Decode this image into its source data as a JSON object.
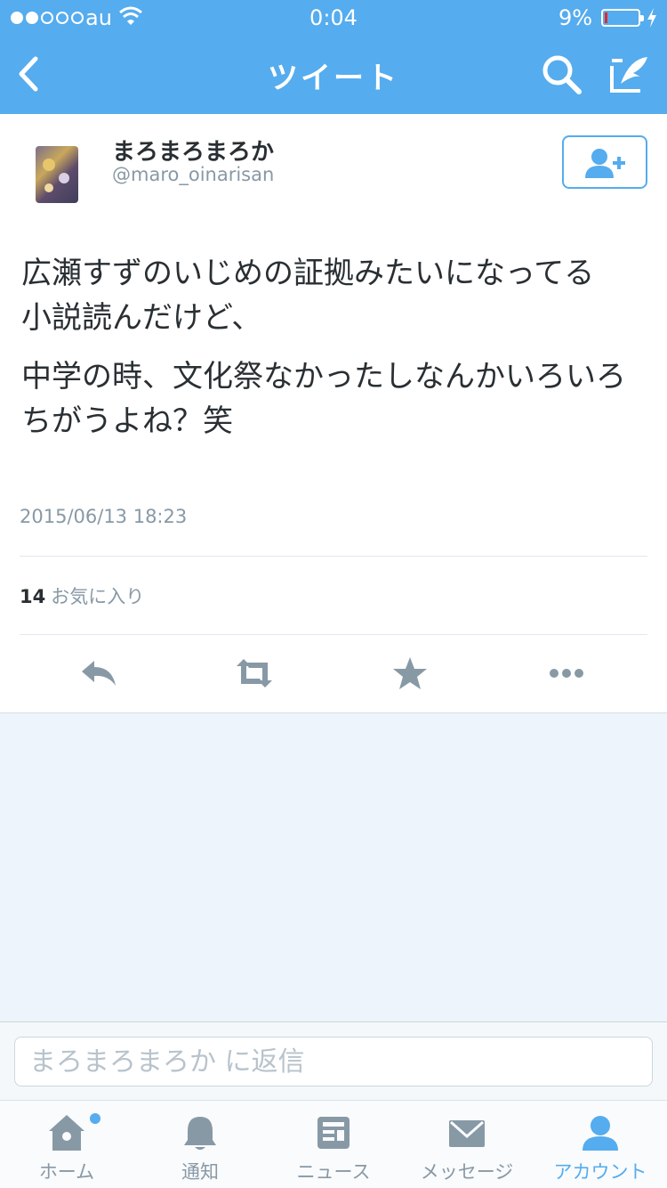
{
  "status_bar": {
    "carrier": "au",
    "time": "0:04",
    "battery_percent": "9%",
    "battery_level": 0.09,
    "signal_bars": 2,
    "signal_total": 5
  },
  "nav": {
    "title": "ツイート",
    "icons": [
      "chevron-left-icon",
      "search-icon",
      "compose-icon"
    ]
  },
  "tweet": {
    "display_name": "まろまろまろか",
    "handle": "@maro_oinarisan",
    "paragraph_1": "広瀬すずのいじめの証拠みたいになってる\n小説読んだけど、",
    "paragraph_2": "中学の時、文化祭なかったしなんかいろいろちがうよね？笑",
    "timestamp": "2015/06/13 18:23",
    "favorites_count": "14",
    "favorites_label": "お気に入り"
  },
  "actions": [
    "reply-icon",
    "retweet-icon",
    "favorite-icon",
    "more-icon"
  ],
  "reply": {
    "placeholder": "まろまろまろか に返信"
  },
  "tabs": [
    {
      "label": "ホーム",
      "icon": "home-icon",
      "has_notification_dot": true
    },
    {
      "label": "通知",
      "icon": "bell-icon"
    },
    {
      "label": "ニュース",
      "icon": "news-icon"
    },
    {
      "label": "メッセージ",
      "icon": "envelope-icon"
    },
    {
      "label": "アカウント",
      "icon": "person-icon",
      "active": true
    }
  ],
  "colors": {
    "brand": "#55acee",
    "text": "#292f33",
    "muted": "#8899a6",
    "background": "#eef4fb",
    "battery_low": "#e0292b"
  }
}
